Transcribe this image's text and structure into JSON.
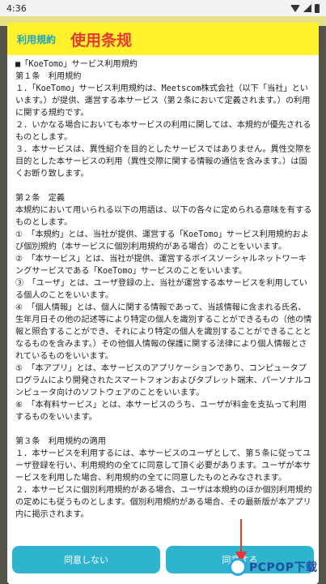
{
  "status_bar": {
    "time": "4:36"
  },
  "header": {
    "tab_small": "利用規約",
    "tab_large": "使用条规"
  },
  "terms_text": "■「KoeTomo」サービス利用規約\n第１条　利用規約\n１．「KoeTomo」サービス利用規約は、Meetscom株式会社（以下「当社」といいます。）が提供、運営する本サービス（第２条において定義されます。）の利用に関する規約です。\n２．いかなる場合においても本サービスの利用に関しては、本規約が優先されるものとします。\n３．本サービスは、異性紹介を目的としたサービスではありません。異性交際を目的とした本サービスの利用（異性交際に関する情報の通信を含みます。）は固くお断り致します。\n\n第２条　定義\n本規約において用いられる以下の用語は、以下の各々に定められる意味を有するものとします。\n①　「本規約」とは、当社が提供、運営する「KoeTomo」サービス利用規約および個別規約（本サービスに個別利用規約がある場合）のことをいいます。\n②　「本サービス」とは、当社が提供、運営するボイスソーシャルネットワーキングサービスである「KoeTomo」サービスのことをいいます。\n③　「ユーザ」とは、ユーザ登録の上、当社が運営する本サービスを利用している個人のことをいいます。\n④　「個人情報」とは、個人に関する情報であって、当該情報に含まれる氏名、生年月日その他の記述等により特定の個人を識別することができるもの（他の情報と照合することができ、それにより特定の個人を識別することができることとなるものを含みます。）その他個人情報の保護に関する法律により個人情報とされているものをいいます。\n⑤　「本アプリ」とは、本サービスのアプリケーションであり、コンピュータプログラムにより開発されたスマートフォンおよびタブレット端末、パーソナルコンピュータ向けのソフトウェアのことをいいます。\n⑥　「本有料サービス」とは、本サービスのうち、ユーザが料金を支払って利用するものをいいます。\n\n第３条　利用規約の適用\n１．本サービスを利用するには、本サービスのユーザとして、第５条に従ってユーザ登録を行い、利用規約の全てに同意して頂く必要があります。ユーザが本サービスを利用した場合、利用規約の全てに同意したものとみなされます。\n２．本サービスに個別利用規約がある場合、ユーザは本規約のほか個別利用規約の定めにも従うものとします。個別利用規約がある場合、その最新版が本アプリ内に掲示されます。",
  "footer": {
    "decline_label": "同意しない",
    "agree_label": "同意する"
  },
  "watermark": {
    "text": "PCPOP下载"
  }
}
